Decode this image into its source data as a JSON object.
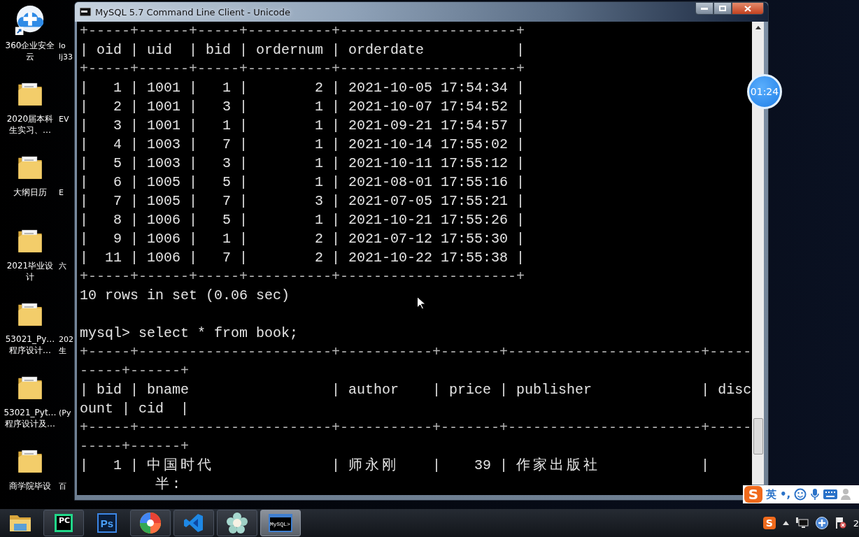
{
  "desktop": {
    "icons": [
      {
        "kind": "cloud",
        "label_lines": [
          "360企业安全",
          "云"
        ]
      },
      {
        "kind": "folder",
        "label_lines": [
          "2020届本科",
          "生实习、…"
        ]
      },
      {
        "kind": "folder",
        "label_lines": [
          "大纲日历"
        ]
      },
      {
        "kind": "folder",
        "label_lines": [
          "2021毕业设",
          "计"
        ]
      },
      {
        "kind": "folder",
        "label_lines": [
          "53021_Py…",
          "程序设计…"
        ]
      },
      {
        "kind": "folder",
        "label_lines": [
          "53021_Pyt…",
          "程序设计及…"
        ]
      },
      {
        "kind": "folder",
        "label_lines": [
          "商学院毕设"
        ]
      }
    ],
    "partial_icons": [
      {
        "label_lines": [
          "lo",
          "lj33"
        ]
      },
      {
        "label_lines": [
          "EV"
        ]
      },
      {
        "label_lines": [
          "E"
        ]
      },
      {
        "label_lines": [
          "六"
        ]
      },
      {
        "label_lines": [
          "202",
          "生"
        ]
      },
      {
        "label_lines": [
          "(Py"
        ]
      },
      {
        "label_lines": [
          "百"
        ]
      }
    ]
  },
  "window": {
    "title": "MySQL 5.7 Command Line Client - Unicode"
  },
  "console": {
    "lines": [
      {
        "kind": "border",
        "text": "+-----+------+-----+----------+---------------------+"
      },
      {
        "kind": "text",
        "text": "| oid | uid  | bid | ordernum | orderdate           |"
      },
      {
        "kind": "border",
        "text": "+-----+------+-----+----------+---------------------+"
      },
      {
        "kind": "text",
        "text": "|   1 | 1001 |   1 |        2 | 2021-10-05 17:54:34 |"
      },
      {
        "kind": "text",
        "text": "|   2 | 1001 |   3 |        1 | 2021-10-07 17:54:52 |"
      },
      {
        "kind": "text",
        "text": "|   3 | 1001 |   1 |        1 | 2021-09-21 17:54:57 |"
      },
      {
        "kind": "text",
        "text": "|   4 | 1003 |   7 |        1 | 2021-10-14 17:55:02 |"
      },
      {
        "kind": "text",
        "text": "|   5 | 1003 |   3 |        1 | 2021-10-11 17:55:12 |"
      },
      {
        "kind": "text",
        "text": "|   6 | 1005 |   5 |        1 | 2021-08-01 17:55:16 |"
      },
      {
        "kind": "text",
        "text": "|   7 | 1005 |   7 |        3 | 2021-07-05 17:55:21 |"
      },
      {
        "kind": "text",
        "text": "|   8 | 1006 |   5 |        1 | 2021-10-21 17:55:26 |"
      },
      {
        "kind": "text",
        "text": "|   9 | 1006 |   1 |        2 | 2021-07-12 17:55:30 |"
      },
      {
        "kind": "text",
        "text": "|  11 | 1006 |   7 |        2 | 2021-10-22 17:55:38 |"
      },
      {
        "kind": "border",
        "text": "+-----+------+-----+----------+---------------------+"
      },
      {
        "kind": "text",
        "text": "10 rows in set (0.06 sec)"
      },
      {
        "kind": "blank"
      },
      {
        "kind": "text",
        "text": "mysql> select * from book;"
      },
      {
        "kind": "border",
        "text": "+-----+-----------------------+-----------+-------+-----------------------+-----"
      },
      {
        "kind": "border",
        "text": "-----+------+"
      },
      {
        "kind": "text",
        "text": "| bid | bname                 | author    | price | publisher             | disc"
      },
      {
        "kind": "text",
        "text": "ount | cid  |"
      },
      {
        "kind": "border",
        "text": "+-----+-----------------------+-----------+-------+-----------------------+-----"
      },
      {
        "kind": "border",
        "text": "-----+------+"
      },
      {
        "kind": "text",
        "text": "|   1 | 中国时代              | 师永刚    |    39 | 作家出版社            |"
      },
      {
        "kind": "text",
        "text": "         半:"
      }
    ]
  },
  "timer": {
    "text": "01:24"
  },
  "ime_bar": {
    "logo": "S",
    "language": "英",
    "punctuation": "•,"
  },
  "taskbar": {
    "items": [
      {
        "kind": "explorer",
        "running": false,
        "selected": false
      },
      {
        "kind": "pycharm",
        "label": "PC",
        "running": true,
        "selected": false
      },
      {
        "kind": "photoshop",
        "label": "Ps",
        "running": false,
        "selected": false
      },
      {
        "kind": "pinwheel",
        "running": true,
        "selected": false
      },
      {
        "kind": "vscode",
        "running": true,
        "selected": false
      },
      {
        "kind": "flower",
        "running": true,
        "selected": false
      },
      {
        "kind": "console",
        "label": "MySQL>",
        "running": true,
        "selected": true
      }
    ],
    "tray": {
      "ime_logo": "S",
      "clock": "2"
    }
  }
}
